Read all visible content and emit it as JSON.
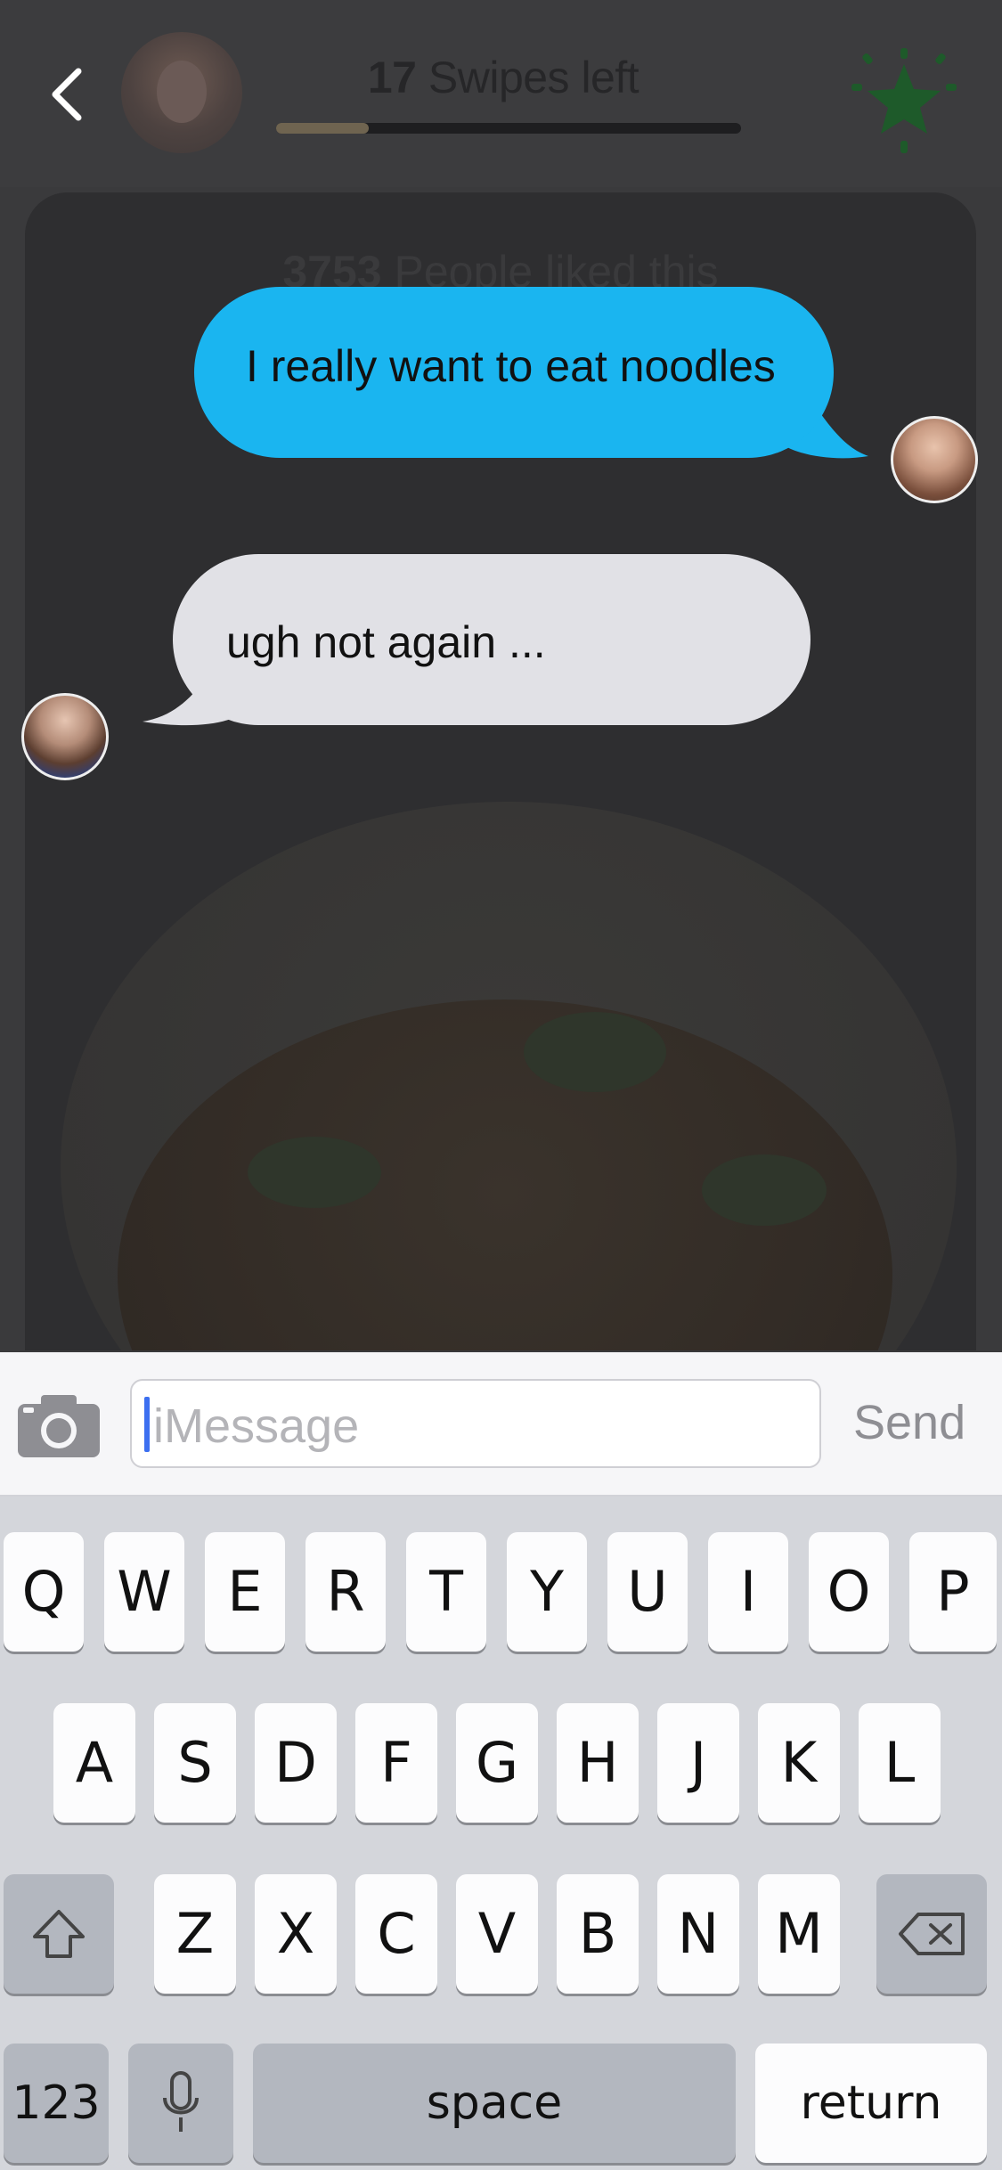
{
  "header": {
    "swipes_count": "17",
    "swipes_label": "Swipes left",
    "swipes_progress_fraction": 0.2
  },
  "card": {
    "likes_count": "3753",
    "likes_label": "People liked this"
  },
  "chat": {
    "outgoing_message": "I really want to eat noodles",
    "incoming_message": "ugh not again ..."
  },
  "compose": {
    "placeholder": "iMessage",
    "send_label": "Send"
  },
  "keyboard": {
    "row1": [
      "Q",
      "W",
      "E",
      "R",
      "T",
      "Y",
      "U",
      "I",
      "O",
      "P"
    ],
    "row2": [
      "A",
      "S",
      "D",
      "F",
      "G",
      "H",
      "J",
      "K",
      "L"
    ],
    "row3": [
      "Z",
      "X",
      "C",
      "V",
      "B",
      "N",
      "M"
    ],
    "numbers_label": "123",
    "space_label": "space",
    "return_label": "return"
  },
  "colors": {
    "outgoing_bubble": "#1ab5f0",
    "incoming_bubble": "#e1e1e6",
    "caret": "#3c6ff0",
    "star": "#1e5a2a"
  },
  "icons": [
    "back-chevron-icon",
    "star-icon",
    "camera-icon",
    "shift-icon",
    "delete-icon",
    "microphone-icon"
  ]
}
